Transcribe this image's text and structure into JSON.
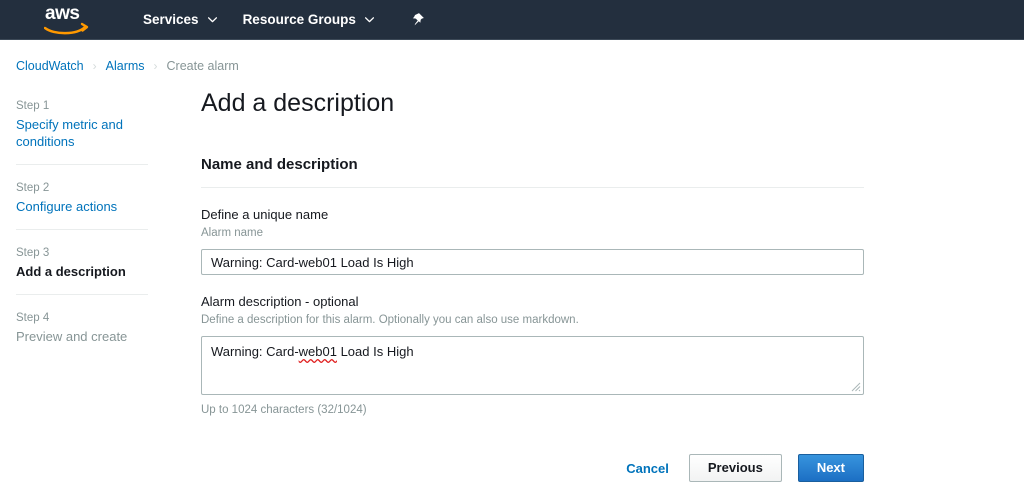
{
  "navbar": {
    "logo_alt": "aws",
    "items": [
      {
        "label": "Services",
        "icon": "chevron-down-icon"
      },
      {
        "label": "Resource Groups",
        "icon": "chevron-down-icon"
      }
    ],
    "pin_icon": "pushpin-icon",
    "background": "#232f3e"
  },
  "breadcrumb": {
    "items": [
      {
        "label": "CloudWatch",
        "current": false
      },
      {
        "label": "Alarms",
        "current": false
      },
      {
        "label": "Create alarm",
        "current": true
      }
    ],
    "separator": "›",
    "link_color": "#0073bb"
  },
  "steps": [
    {
      "number": "Step 1",
      "label": "Specify metric and conditions",
      "state": "link"
    },
    {
      "number": "Step 2",
      "label": "Configure actions",
      "state": "link"
    },
    {
      "number": "Step 3",
      "label": "Add a description",
      "state": "active"
    },
    {
      "number": "Step 4",
      "label": "Preview and create",
      "state": "disabled"
    }
  ],
  "main": {
    "page_title": "Add a description",
    "section_title": "Name and description",
    "name_field": {
      "label": "Define a unique name",
      "hint": "Alarm name",
      "value": "Warning: Card-web01 Load Is High",
      "placeholder": ""
    },
    "description_field": {
      "label": "Alarm description - optional",
      "hint": "Define a description for this alarm. Optionally you can also use markdown.",
      "value": "Warning: Card-web01 Load Is High",
      "value_prefix": "Warning: Card-",
      "value_misspelled": "web01",
      "value_suffix": " Load Is High",
      "placeholder": "",
      "counter": "Up to 1024 characters (32/1024)"
    }
  },
  "actions": {
    "cancel_label": "Cancel",
    "previous_label": "Previous",
    "next_label": "Next",
    "primary_color": "#1c6fc4"
  }
}
